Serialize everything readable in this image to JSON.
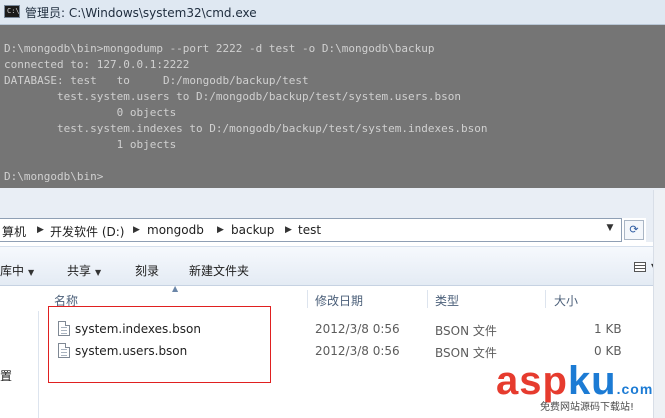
{
  "cmd": {
    "title": "管理员: C:\\Windows\\system32\\cmd.exe",
    "lines": [
      "D:\\mongodb\\bin>mongodump --port 2222 -d test -o D:\\mongodb\\backup",
      "connected to: 127.0.0.1:2222",
      "DATABASE: test   to     D:/mongodb/backup/test",
      "        test.system.users to D:/mongodb/backup/test/system.users.bson",
      "                 0 objects",
      "        test.system.indexes to D:/mongodb/backup/test/system.indexes.bson",
      "                 1 objects",
      "",
      "D:\\mongodb\\bin>"
    ]
  },
  "explorer": {
    "breadcrumbs": [
      "算机",
      "开发软件 (D:)",
      "mongodb",
      "backup",
      "test"
    ],
    "toolbar": {
      "library_label": "库中",
      "share_label": "共享",
      "burn_label": "刻录",
      "new_folder_label": "新建文件夹"
    },
    "columns": {
      "name": "名称",
      "modified": "修改日期",
      "type": "类型",
      "size": "大小"
    },
    "files": [
      {
        "name": "system.indexes.bson",
        "modified": "2012/3/8 0:56",
        "type": "BSON 文件",
        "size": "1 KB"
      },
      {
        "name": "system.users.bson",
        "modified": "2012/3/8 0:56",
        "type": "BSON 文件",
        "size": "0 KB"
      }
    ],
    "nav_pane": {
      "item_label": "置"
    }
  },
  "watermark": {
    "text_left": "asp",
    "text_right": "ku",
    "suffix": ".com",
    "subtitle": "免费网站源码下载站!"
  },
  "colors": {
    "cmd_background": "#757575",
    "cmd_text": "#d0d0d0",
    "highlight_border": "#e02020",
    "watermark_red": "#e63b2e",
    "watermark_blue": "#1c7bd4"
  }
}
